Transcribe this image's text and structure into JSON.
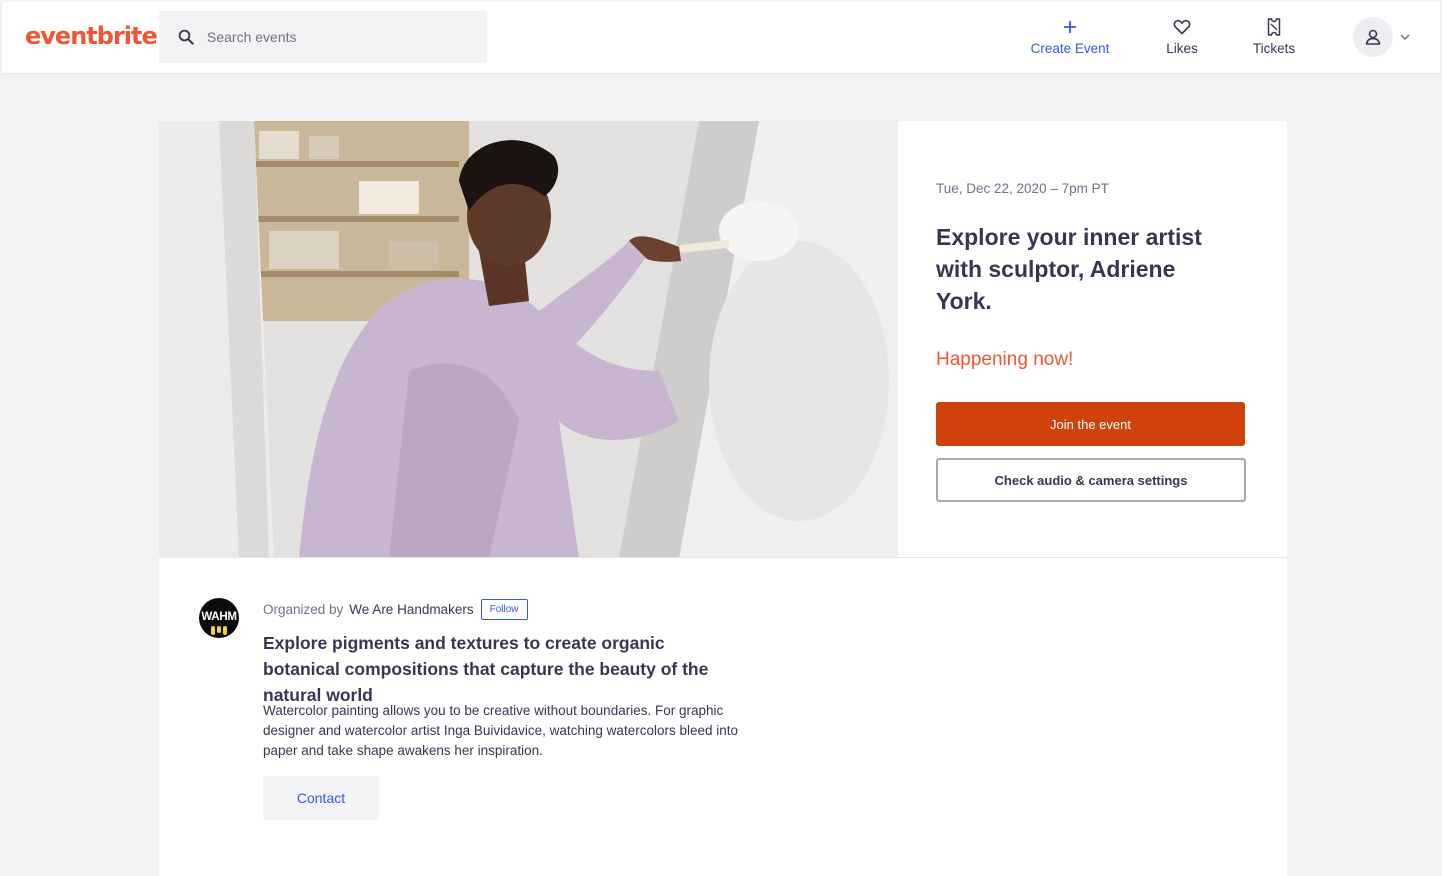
{
  "header": {
    "logo": "eventbrite",
    "search": {
      "placeholder": "Search events",
      "value": ""
    },
    "nav": {
      "create_event": "Create Event",
      "likes": "Likes",
      "tickets": "Tickets"
    },
    "icons": [
      "search-icon",
      "plus-icon",
      "heart-icon",
      "ticket-icon",
      "user-icon",
      "chevron-down-icon"
    ]
  },
  "event": {
    "date": "Tue, Dec 22, 2020 – 7pm PT",
    "title": "Explore your inner artist with sculptor, Adriene York.",
    "status": "Happening now!",
    "join_label": "Join the event",
    "check_label": "Check audio & camera settings"
  },
  "organizer": {
    "prefix": "Organized by",
    "name": "We Are Handmakers",
    "logo_text": "WAHM",
    "follow_label": "Follow",
    "summary": "Explore pigments and textures to create organic botanical compositions that capture the beauty of the natural world",
    "description": "Watercolor painting allows you to be creative without boundaries. For graphic designer and watercolor artist Inga Buividavice, watching watercolors bleed into paper and take shape awakens her inspiration.",
    "contact_label": "Contact"
  },
  "colors": {
    "brand": "#f05537",
    "primary_button": "#d1410c",
    "link_blue": "#3659e3",
    "text": "#39364f",
    "muted": "#6f7287",
    "page_bg": "#f3f3f5"
  }
}
